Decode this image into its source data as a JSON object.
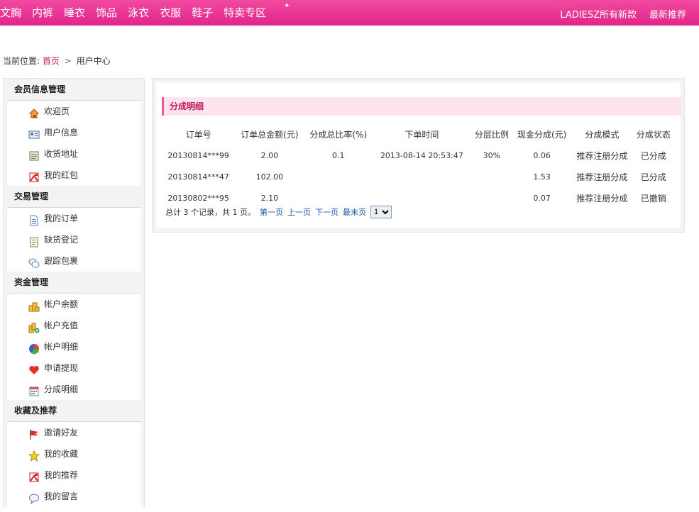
{
  "nav": {
    "categories": [
      "文胸",
      "内裤",
      "睡衣",
      "饰品",
      "泳衣",
      "衣服",
      "鞋子",
      "特卖专区"
    ],
    "right_links": [
      "LADIESZ所有新款",
      "最新推荐"
    ]
  },
  "breadcrumb": {
    "prefix": "当前位置:",
    "home": "首页",
    "separator": ">",
    "current": "用户中心"
  },
  "sidebar": {
    "groups": [
      {
        "title": "会员信息管理",
        "items": [
          {
            "label": "欢迎页",
            "icon": "house-icon"
          },
          {
            "label": "用户信息",
            "icon": "id-card-icon"
          },
          {
            "label": "收货地址",
            "icon": "address-book-icon"
          },
          {
            "label": "我的红包",
            "icon": "red-envelope-icon"
          }
        ]
      },
      {
        "title": "交易管理",
        "items": [
          {
            "label": "我的订单",
            "icon": "document-icon"
          },
          {
            "label": "缺货登记",
            "icon": "note-icon"
          },
          {
            "label": "跟踪包裹",
            "icon": "chat-bubbles-icon"
          }
        ]
      },
      {
        "title": "资金管理",
        "items": [
          {
            "label": "帐户余额",
            "icon": "coins-icon"
          },
          {
            "label": "帐户充值",
            "icon": "coins-add-icon"
          },
          {
            "label": "帐户明细",
            "icon": "pie-chart-icon"
          },
          {
            "label": "申请提现",
            "icon": "heart-icon"
          },
          {
            "label": "分成明细",
            "icon": "calendar-icon"
          }
        ]
      },
      {
        "title": "收藏及推荐",
        "items": [
          {
            "label": "邀请好友",
            "icon": "flag-icon"
          },
          {
            "label": "我的收藏",
            "icon": "star-icon"
          },
          {
            "label": "我的推荐",
            "icon": "red-envelope-icon"
          },
          {
            "label": "我的留言",
            "icon": "speech-bubble-icon"
          }
        ]
      }
    ]
  },
  "panel": {
    "title": "分成明细",
    "columns": [
      "订单号",
      "订单总金额(元)",
      "分成总比率(%)",
      "下单时间",
      "分层比例",
      "现金分成(元)",
      "分成模式",
      "分成状态"
    ],
    "rows": [
      [
        "20130814***99",
        "2.00",
        "0.1",
        "2013-08-14 20:53:47",
        "30%",
        "0.06",
        "推荐注册分成",
        "已分成"
      ],
      [
        "20130814***47",
        "102.00",
        "",
        "",
        "",
        "1.53",
        "推荐注册分成",
        "已分成"
      ],
      [
        "20130802***95",
        "2.10",
        "",
        "",
        "",
        "0.07",
        "推荐注册分成",
        "已撤销"
      ]
    ],
    "pager": {
      "summary": "总计 3 个记录，共 1 页。",
      "first": "第一页",
      "prev": "上一页",
      "next": "下一页",
      "last": "最末页",
      "page_select": "1"
    }
  },
  "colors": {
    "nav_pink": "#e0268a",
    "title_pink": "#c0185e",
    "link_blue": "#1a57a8",
    "title_bg": "#ffe4ee"
  }
}
